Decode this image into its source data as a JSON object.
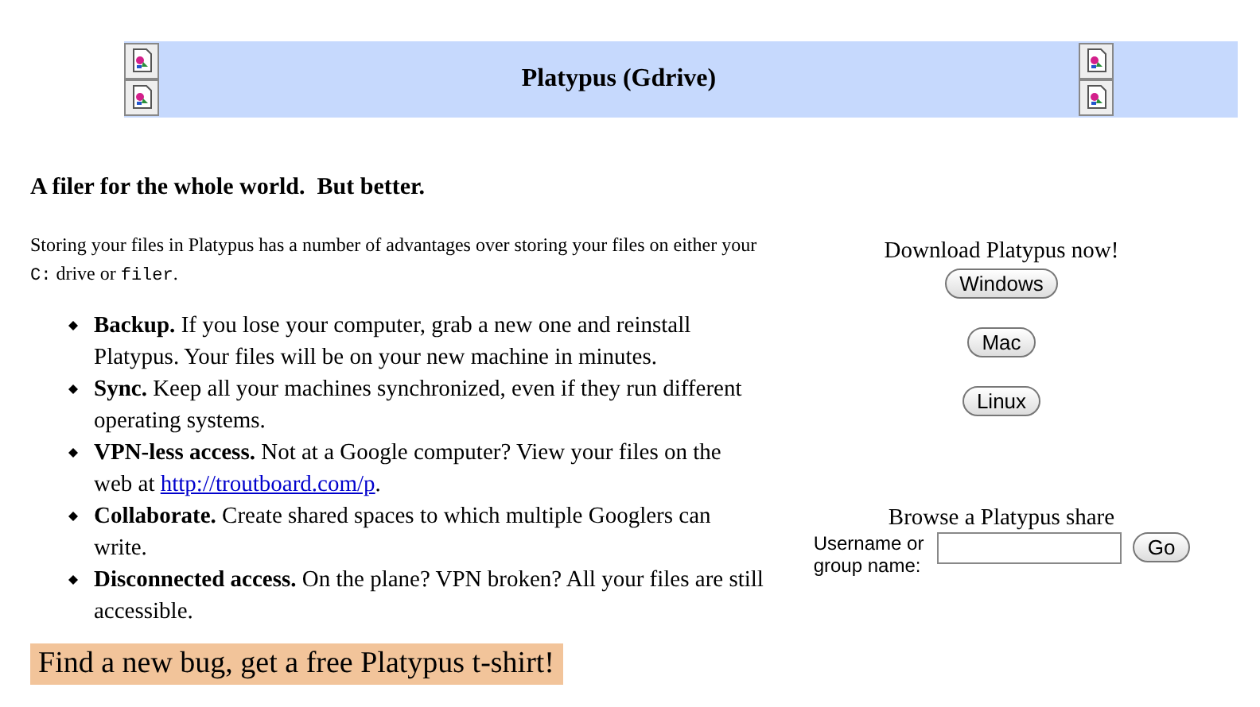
{
  "header": {
    "title": "Platypus (Gdrive)",
    "left_icons": [
      {
        "kind": "broken_image"
      },
      {
        "kind": "broken_image"
      }
    ],
    "right_icons": [
      {
        "kind": "broken_image"
      },
      {
        "kind": "broken_image"
      }
    ]
  },
  "tagline": "A filer for the whole world.  But better.",
  "intro": [
    {
      "kind": "text",
      "text": "Storing your files in Platypus has a number of advantages over storing your files on either your"
    },
    {
      "kind": "code",
      "text": "C:"
    },
    {
      "kind": "text",
      "text": "drive or"
    },
    {
      "kind": "code",
      "text": "filer"
    },
    {
      "kind": "text",
      "text": "."
    }
  ],
  "features": [
    {
      "title": "Backup.",
      "text": "If you lose your computer, grab a new one and reinstall Platypus. Your files will be on your new machine in minutes."
    },
    {
      "title": "Sync.",
      "text": "Keep all your machines synchronized, even if they run different operating systems."
    },
    {
      "title": "VPN-less access.",
      "text": "Not at a Google computer? View your files on the web at",
      "link": "http://troutboard.com/p",
      "after": "."
    },
    {
      "title": "Collaborate.",
      "text": "Create shared spaces to which multiple Googlers can write."
    },
    {
      "title": "Disconnected access.",
      "text": "On the plane? VPN broken? All your files are still accessible."
    }
  ],
  "promo": "Find a new bug, get a free Platypus t-shirt!",
  "download": {
    "heading": "Download Platypus now!",
    "buttons": [
      "Windows",
      "Mac",
      "Linux"
    ]
  },
  "browse": {
    "heading": "Browse a Platypus share",
    "label": "Username or group name:",
    "button": "Go"
  }
}
